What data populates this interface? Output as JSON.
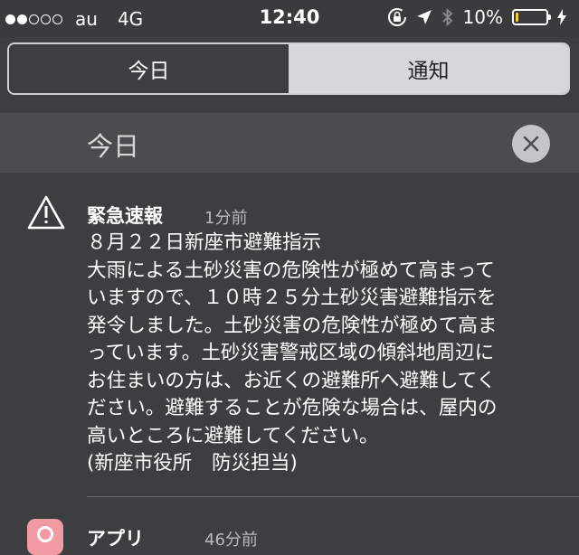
{
  "status_bar": {
    "signal_bars": 2,
    "signal_total": 5,
    "carrier": "au",
    "network": "4G",
    "time": "12:40",
    "battery_percent": "10%",
    "battery_level": 0.1,
    "battery_color": "#f5cf2a",
    "icons": [
      "orientation-lock-icon",
      "location-arrow-icon",
      "bluetooth-icon",
      "battery-icon",
      "charging-bolt-icon"
    ]
  },
  "tabs": {
    "today": "今日",
    "notifications": "通知",
    "selected": "notifications"
  },
  "section": {
    "title": "今日",
    "close_icon": "close-icon"
  },
  "notification": {
    "icon": "warning-triangle-icon",
    "title": "緊急速報",
    "time": "1分前",
    "body_lines": [
      "８月２２日新座市避難指示",
      "大雨による土砂災害の危険性が極めて高まって",
      "いますので、１０時２５分土砂災害避難指示を",
      "発令しました。土砂災害の危険性が極めて高ま",
      "っています。土砂災害警戒区域の傾斜地周辺に",
      "お住まいの方は、お近くの避難所へ避難してく",
      "ださい。避難することが危険な場合は、屋内の",
      "高いところに避難してください。",
      "(新座市役所　防災担当)"
    ]
  },
  "next_notification": {
    "icon": "app-icon",
    "title": "アプリ",
    "time": "46分前"
  }
}
